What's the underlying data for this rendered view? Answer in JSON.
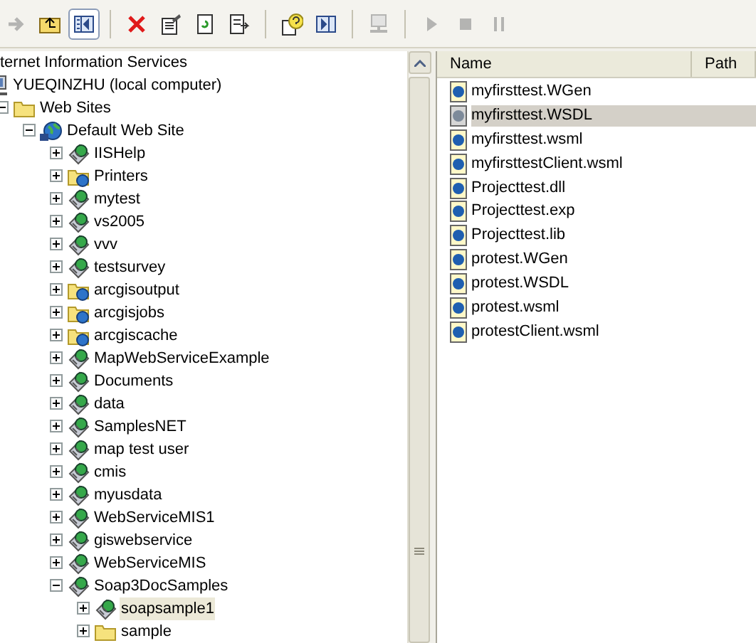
{
  "toolbar": [
    {
      "kind": "forward",
      "disabled": true,
      "pressed": false
    },
    {
      "kind": "up",
      "disabled": false,
      "pressed": false
    },
    {
      "kind": "tree",
      "disabled": false,
      "pressed": true
    },
    {
      "kind": "delete",
      "disabled": false,
      "pressed": false
    },
    {
      "kind": "properties",
      "disabled": false,
      "pressed": false
    },
    {
      "kind": "refresh",
      "disabled": false,
      "pressed": false
    },
    {
      "kind": "export",
      "disabled": false,
      "pressed": false
    },
    {
      "kind": "help",
      "disabled": false,
      "pressed": false
    },
    {
      "kind": "panel",
      "disabled": false,
      "pressed": false
    },
    {
      "kind": "computer",
      "disabled": true,
      "pressed": false
    },
    {
      "kind": "play",
      "disabled": true,
      "pressed": false
    },
    {
      "kind": "stop",
      "disabled": true,
      "pressed": false
    },
    {
      "kind": "pause",
      "disabled": true,
      "pressed": false
    }
  ],
  "tree": {
    "label": "ternet Information Services",
    "selected": false,
    "children": [
      {
        "label": "YUEQINZHU (local computer)",
        "kind": "computer",
        "selected": false,
        "children": [
          {
            "label": "Web Sites",
            "kind": "folder",
            "expanded": true,
            "selected": false,
            "children": [
              {
                "label": "Default Web Site",
                "kind": "site",
                "expanded": true,
                "selected": false,
                "children": [
                  {
                    "label": "IISHelp",
                    "kind": "app",
                    "expanded": false,
                    "selected": false
                  },
                  {
                    "label": "Printers",
                    "kind": "vdir",
                    "expanded": false,
                    "selected": false
                  },
                  {
                    "label": "mytest",
                    "kind": "app",
                    "expanded": false,
                    "selected": false
                  },
                  {
                    "label": "vs2005",
                    "kind": "app",
                    "expanded": false,
                    "selected": false
                  },
                  {
                    "label": "vvv",
                    "kind": "app",
                    "expanded": false,
                    "selected": false
                  },
                  {
                    "label": "testsurvey",
                    "kind": "app",
                    "expanded": false,
                    "selected": false
                  },
                  {
                    "label": "arcgisoutput",
                    "kind": "vdir",
                    "expanded": false,
                    "selected": false
                  },
                  {
                    "label": "arcgisjobs",
                    "kind": "vdir",
                    "expanded": false,
                    "selected": false
                  },
                  {
                    "label": "arcgiscache",
                    "kind": "vdir",
                    "expanded": false,
                    "selected": false
                  },
                  {
                    "label": "MapWebServiceExample",
                    "kind": "app",
                    "expanded": false,
                    "selected": false
                  },
                  {
                    "label": "Documents",
                    "kind": "app",
                    "expanded": false,
                    "selected": false
                  },
                  {
                    "label": "data",
                    "kind": "app",
                    "expanded": false,
                    "selected": false
                  },
                  {
                    "label": "SamplesNET",
                    "kind": "app",
                    "expanded": false,
                    "selected": false
                  },
                  {
                    "label": "map test user",
                    "kind": "app",
                    "expanded": false,
                    "selected": false
                  },
                  {
                    "label": "cmis",
                    "kind": "app",
                    "expanded": false,
                    "selected": false
                  },
                  {
                    "label": "myusdata",
                    "kind": "app",
                    "expanded": false,
                    "selected": false
                  },
                  {
                    "label": "WebServiceMIS1",
                    "kind": "app",
                    "expanded": false,
                    "selected": false
                  },
                  {
                    "label": "giswebservice",
                    "kind": "app",
                    "expanded": false,
                    "selected": false
                  },
                  {
                    "label": "WebServiceMIS",
                    "kind": "app",
                    "expanded": false,
                    "selected": false
                  },
                  {
                    "label": "Soap3DocSamples",
                    "kind": "app",
                    "expanded": true,
                    "selected": false,
                    "children": [
                      {
                        "label": "soapsample1",
                        "kind": "app",
                        "expanded": false,
                        "selected": true
                      },
                      {
                        "label": "sample",
                        "kind": "folder",
                        "expanded": false,
                        "selected": false
                      }
                    ]
                  }
                ]
              }
            ]
          }
        ]
      }
    ]
  },
  "list": {
    "columns": [
      "Name",
      "Path"
    ],
    "rows": [
      {
        "name": "myfirsttest.WGen",
        "selected": false
      },
      {
        "name": "myfirsttest.WSDL",
        "selected": true
      },
      {
        "name": "myfirsttest.wsml",
        "selected": false
      },
      {
        "name": "myfirsttestClient.wsml",
        "selected": false
      },
      {
        "name": "Projecttest.dll",
        "selected": false
      },
      {
        "name": "Projecttest.exp",
        "selected": false
      },
      {
        "name": "Projecttest.lib",
        "selected": false
      },
      {
        "name": "protest.WGen",
        "selected": false
      },
      {
        "name": "protest.WSDL",
        "selected": false
      },
      {
        "name": "protest.wsml",
        "selected": false
      },
      {
        "name": "protestClient.wsml",
        "selected": false
      }
    ]
  }
}
